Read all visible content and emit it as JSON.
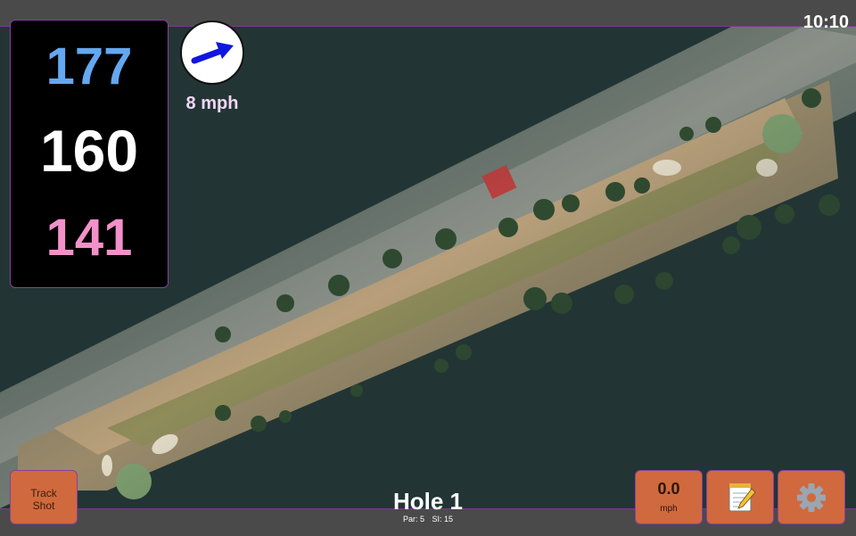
{
  "status": {
    "time": "10:10"
  },
  "distances": {
    "back": "177",
    "middle": "160",
    "front": "141"
  },
  "wind": {
    "speed": "8 mph",
    "icon": "wind-direction-arrow-icon"
  },
  "track_shot": {
    "line1": "Track",
    "line2": "Shot"
  },
  "hole": {
    "title": "Hole 1",
    "par": "Par: 5",
    "si": "SI: 15"
  },
  "speed": {
    "value": "0.0",
    "unit": "mph"
  },
  "icons": {
    "notes": "notepad-icon",
    "settings": "gear-icon"
  },
  "colors": {
    "back_distance": "#64a8f0",
    "middle_distance": "#ffffff",
    "front_distance": "#f291c9",
    "button": "#d0693e",
    "accent_border": "#8a3fa0"
  }
}
